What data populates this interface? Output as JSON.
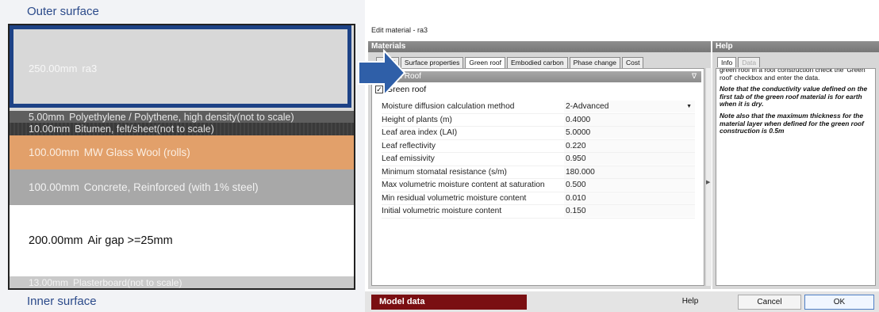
{
  "construction": {
    "outer_label": "Outer surface",
    "inner_label": "Inner surface",
    "layers": [
      {
        "thickness": "250.00mm",
        "name": "ra3"
      },
      {
        "thickness": "5.00mm",
        "name": "Polyethylene / Polythene, high density(not to scale)"
      },
      {
        "thickness": "10.00mm",
        "name": "Bitumen, felt/sheet(not to scale)"
      },
      {
        "thickness": "100.00mm",
        "name": "MW Glass Wool (rolls)"
      },
      {
        "thickness": "100.00mm",
        "name": "Concrete, Reinforced (with 1% steel)"
      },
      {
        "thickness": "200.00mm",
        "name": "Air gap >=25mm"
      },
      {
        "thickness": "13.00mm",
        "name": "Plasterboard(not to scale)"
      }
    ],
    "selected_color": "#1d4286"
  },
  "dialog": {
    "title": "Edit material - ra3",
    "materials_header": "Materials",
    "tabs": [
      "General",
      "Surface properties",
      "Green roof",
      "Embodied carbon",
      "Phase change",
      "Cost"
    ],
    "tab_display": [
      "neral",
      "Surface properties",
      "Green roof",
      "Embodied carbon",
      "Phase change",
      "Cost"
    ],
    "active_tab": "Green roof",
    "section_title": "reen Roof",
    "checkbox_label": "Green roof",
    "checkbox_checked": "✓",
    "properties": [
      {
        "label": "Moisture diffusion calculation method",
        "value": "2-Advanced"
      },
      {
        "label": "Height of plants (m)",
        "value": "0.4000"
      },
      {
        "label": "Leaf area index (LAI)",
        "value": "5.0000"
      },
      {
        "label": "Leaf reflectivity",
        "value": "0.220"
      },
      {
        "label": "Leaf emissivity",
        "value": "0.950"
      },
      {
        "label": "Minimum stomatal resistance (s/m)",
        "value": "180.000"
      },
      {
        "label": "Max volumetric moisture content at saturation",
        "value": "0.500"
      },
      {
        "label": "Min residual volumetric moisture content",
        "value": "0.010"
      },
      {
        "label": "Initial volumetric moisture content",
        "value": "0.150"
      }
    ],
    "help": {
      "header": "Help",
      "tabs": [
        "Info",
        "Data"
      ],
      "p1": "green roof in a roof construction check the 'Green roof' checkbox and enter the data.",
      "p2": "Note that the conductivity value defined on the first tab of the green roof material is for earth when it is dry.",
      "p3": "Note also that the maximum thickness for the material layer when defined for the green roof construction is 0.5m"
    },
    "footer": {
      "model_data": "Model data",
      "help": "Help",
      "cancel": "Cancel",
      "ok": "OK"
    },
    "accent_color": "#7a0f12"
  }
}
